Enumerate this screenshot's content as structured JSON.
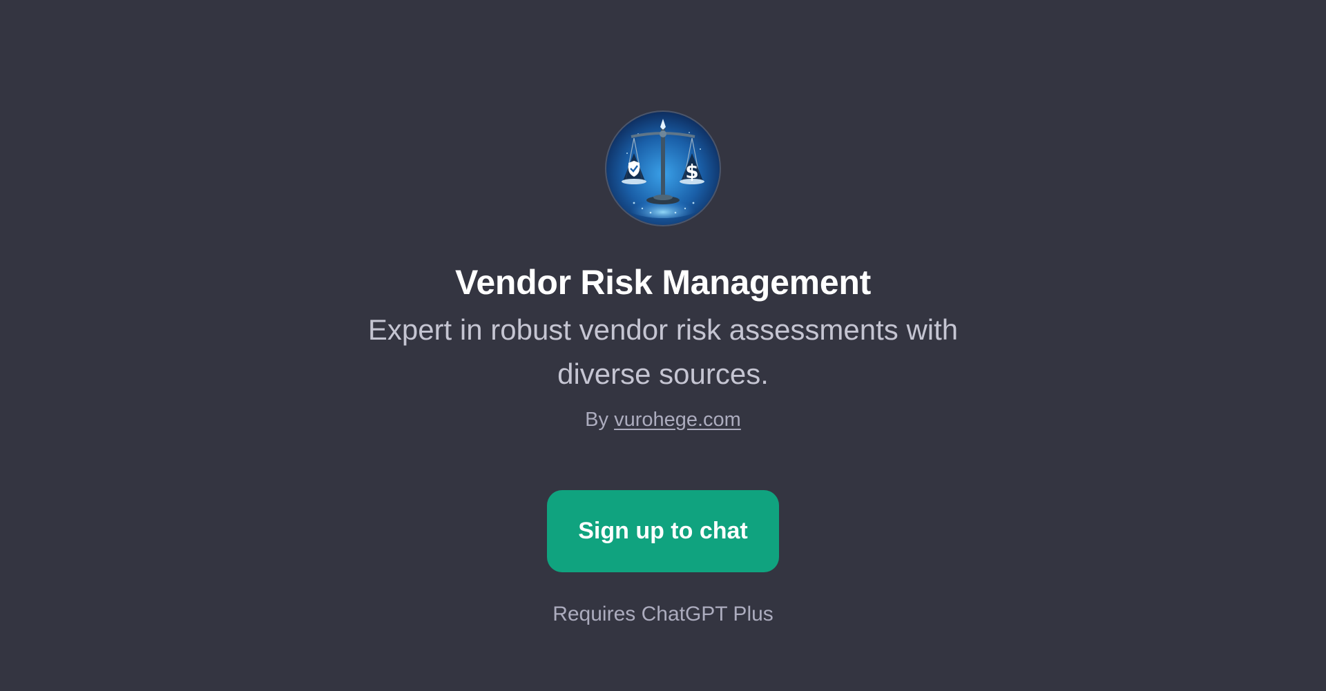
{
  "gpt": {
    "name": "Vendor Risk Management",
    "description": "Expert in robust vendor risk assessments with diverse sources.",
    "byline_prefix": "By",
    "author_link": "vurohege.com",
    "avatar_icon": "balance-scale-shield-dollar-icon"
  },
  "actions": {
    "signup_label": "Sign up to chat",
    "requirement_note": "Requires ChatGPT Plus"
  },
  "colors": {
    "background": "#343541",
    "accent_button": "#10a37f",
    "title": "#ffffff",
    "muted_text": "#acacbe"
  }
}
